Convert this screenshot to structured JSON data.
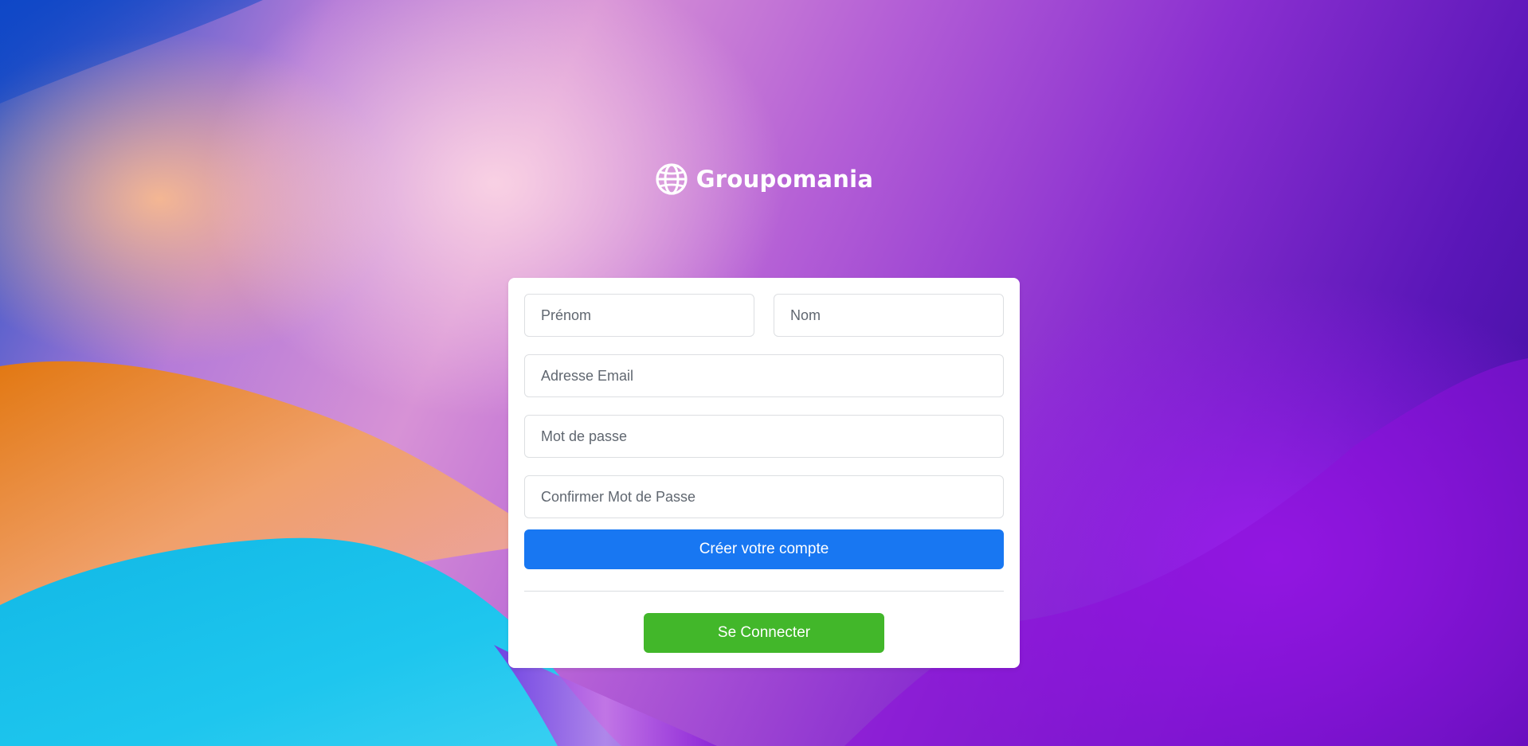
{
  "brand": {
    "name": "Groupomania",
    "icon": "globe-icon"
  },
  "signup_form": {
    "first_name_placeholder": "Prénom",
    "last_name_placeholder": "Nom",
    "email_placeholder": "Adresse Email",
    "password_placeholder": "Mot de passe",
    "confirm_password_placeholder": "Confirmer Mot de Passe",
    "submit_label": "Créer votre compte",
    "login_label": "Se Connecter"
  },
  "colors": {
    "primary_button": "#1877f2",
    "secondary_button": "#42b72a",
    "card_background": "#ffffff"
  }
}
